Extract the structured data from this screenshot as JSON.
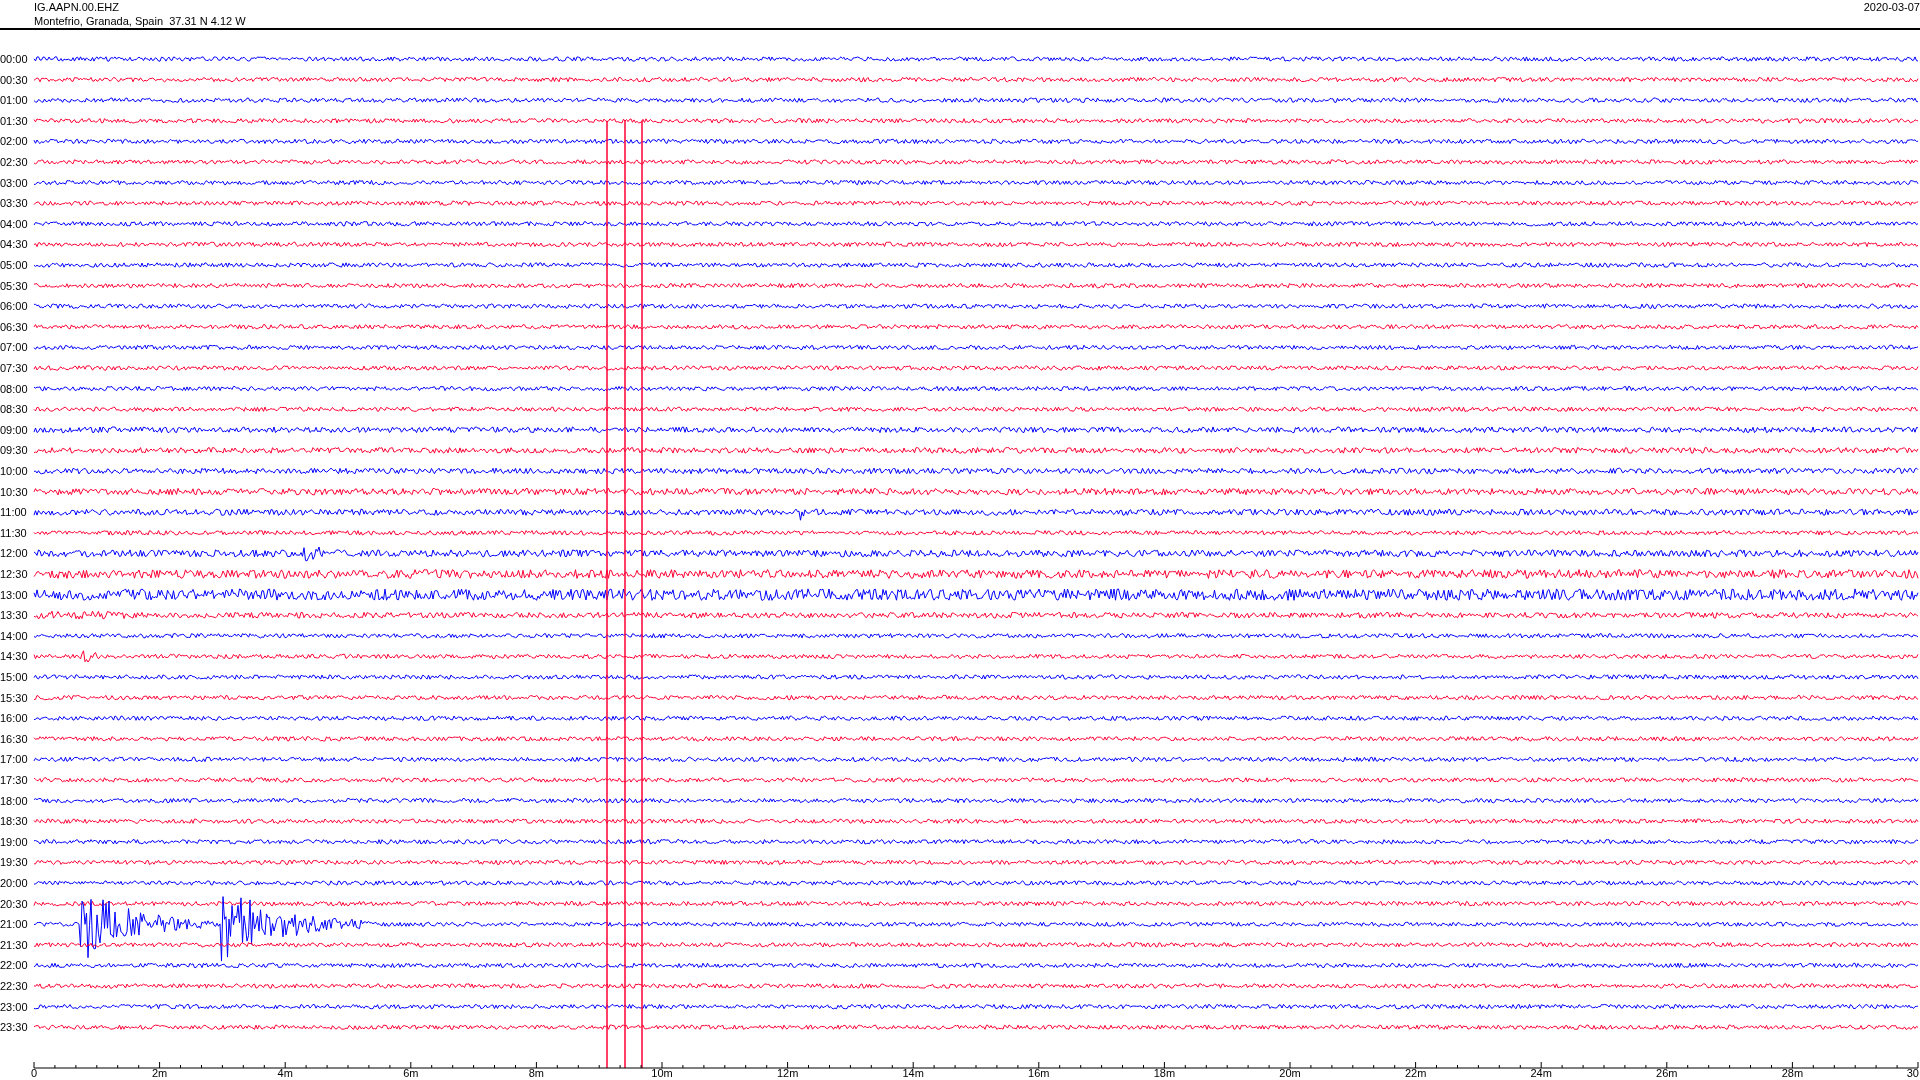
{
  "header": {
    "station": "IG.AAPN.00.EHZ",
    "location": "Montefrio, Granada, Spain  37.31 N 4.12 W",
    "date": "2020-03-07"
  },
  "plot": {
    "rows": [
      {
        "label": "00:00",
        "color": "#0000ff"
      },
      {
        "label": "00:30",
        "color": "#ff0033"
      },
      {
        "label": "01:00",
        "color": "#0000ff"
      },
      {
        "label": "01:30",
        "color": "#ff0033"
      },
      {
        "label": "02:00",
        "color": "#0000ff"
      },
      {
        "label": "02:30",
        "color": "#ff0033"
      },
      {
        "label": "03:00",
        "color": "#0000ff"
      },
      {
        "label": "03:30",
        "color": "#ff0033"
      },
      {
        "label": "04:00",
        "color": "#0000ff"
      },
      {
        "label": "04:30",
        "color": "#ff0033"
      },
      {
        "label": "05:00",
        "color": "#0000ff"
      },
      {
        "label": "05:30",
        "color": "#ff0033"
      },
      {
        "label": "06:00",
        "color": "#0000ff"
      },
      {
        "label": "06:30",
        "color": "#ff0033"
      },
      {
        "label": "07:00",
        "color": "#0000ff"
      },
      {
        "label": "07:30",
        "color": "#ff0033"
      },
      {
        "label": "08:00",
        "color": "#0000ff"
      },
      {
        "label": "08:30",
        "color": "#ff0033"
      },
      {
        "label": "09:00",
        "color": "#0000ff"
      },
      {
        "label": "09:30",
        "color": "#ff0033"
      },
      {
        "label": "10:00",
        "color": "#0000ff"
      },
      {
        "label": "10:30",
        "color": "#ff0033"
      },
      {
        "label": "11:00",
        "color": "#0000ff"
      },
      {
        "label": "11:30",
        "color": "#ff0033"
      },
      {
        "label": "12:00",
        "color": "#0000ff"
      },
      {
        "label": "12:30",
        "color": "#ff0033"
      },
      {
        "label": "13:00",
        "color": "#0000ff"
      },
      {
        "label": "13:30",
        "color": "#ff0033"
      },
      {
        "label": "14:00",
        "color": "#0000ff"
      },
      {
        "label": "14:30",
        "color": "#ff0033"
      },
      {
        "label": "15:00",
        "color": "#0000ff"
      },
      {
        "label": "15:30",
        "color": "#ff0033"
      },
      {
        "label": "16:00",
        "color": "#0000ff"
      },
      {
        "label": "16:30",
        "color": "#ff0033"
      },
      {
        "label": "17:00",
        "color": "#0000ff"
      },
      {
        "label": "17:30",
        "color": "#ff0033"
      },
      {
        "label": "18:00",
        "color": "#0000ff"
      },
      {
        "label": "18:30",
        "color": "#ff0033"
      },
      {
        "label": "19:00",
        "color": "#0000ff"
      },
      {
        "label": "19:30",
        "color": "#ff0033"
      },
      {
        "label": "20:00",
        "color": "#0000ff"
      },
      {
        "label": "20:30",
        "color": "#ff0033"
      },
      {
        "label": "21:00",
        "color": "#0000ff"
      },
      {
        "label": "21:30",
        "color": "#ff0033"
      },
      {
        "label": "22:00",
        "color": "#0000ff"
      },
      {
        "label": "22:30",
        "color": "#ff0033"
      },
      {
        "label": "23:00",
        "color": "#0000ff"
      },
      {
        "label": "23:30",
        "color": "#ff0033"
      }
    ],
    "x_ticks": [
      "0",
      "2m",
      "4m",
      "6m",
      "8m",
      "10m",
      "12m",
      "14m",
      "16m",
      "18m",
      "20m",
      "22m",
      "24m",
      "26m",
      "28m",
      "30"
    ]
  }
}
